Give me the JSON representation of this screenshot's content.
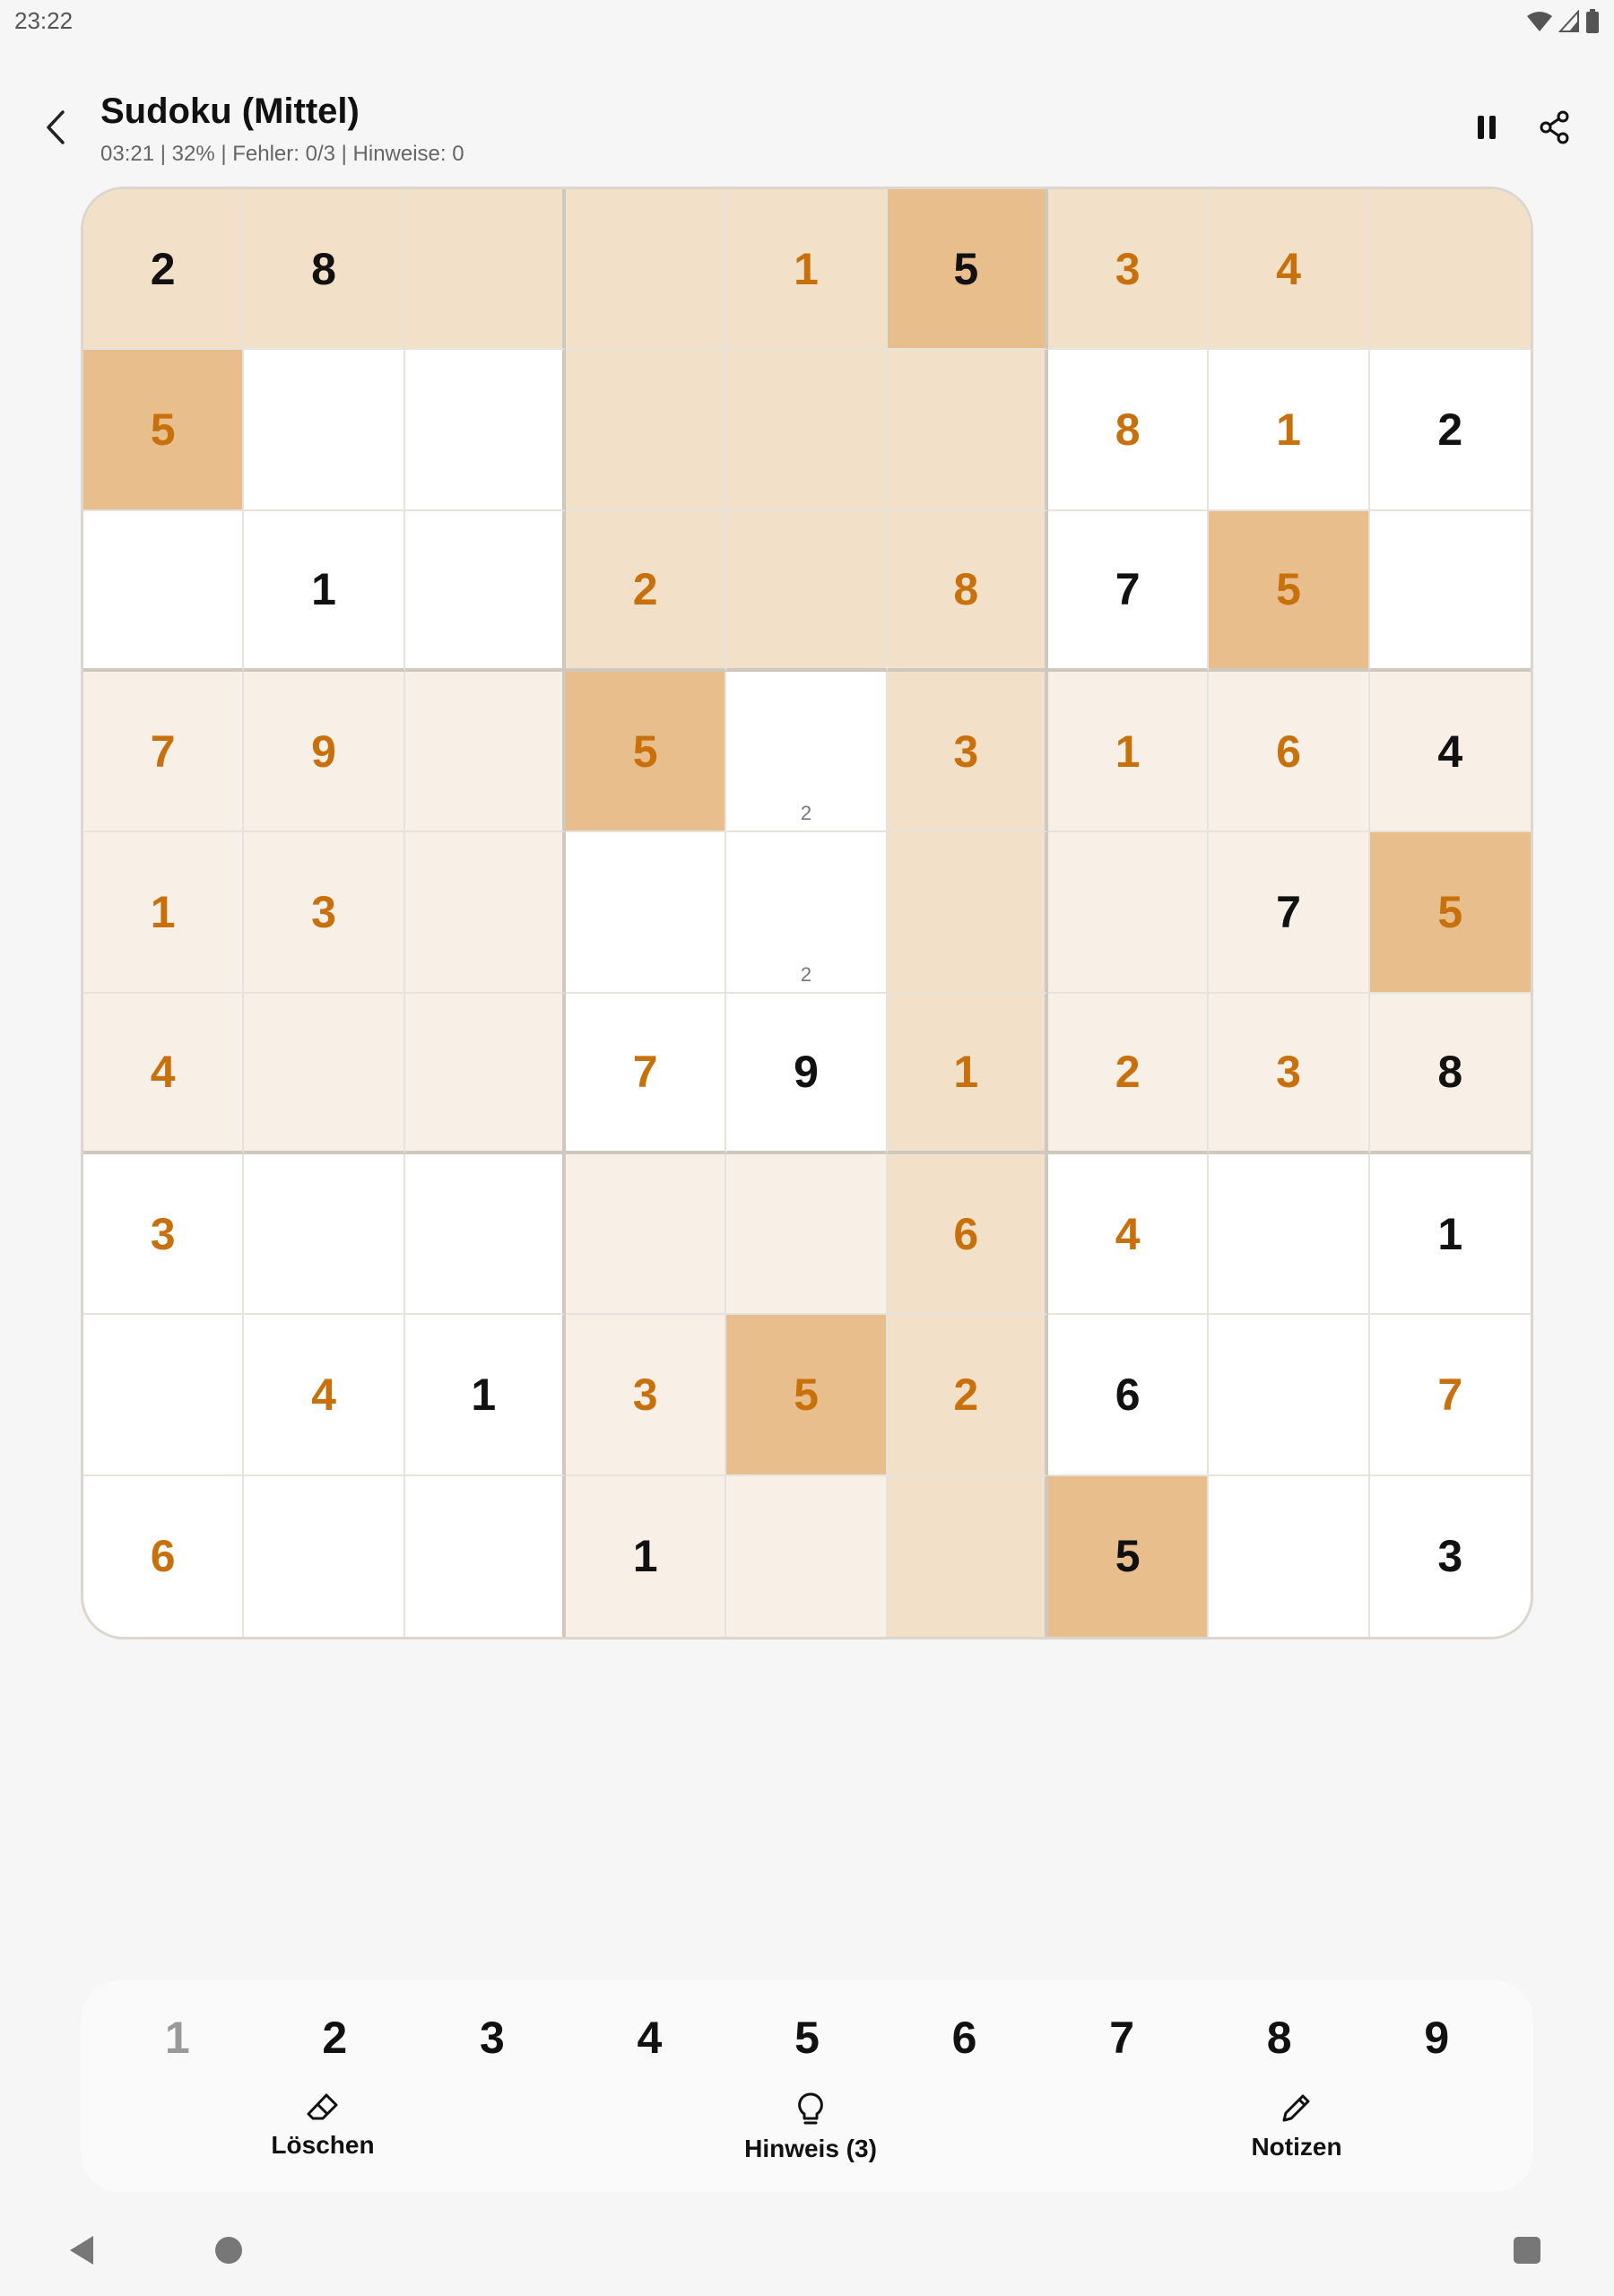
{
  "status_bar": {
    "time": "23:22"
  },
  "header": {
    "title": "Sudoku (Mittel)",
    "subtitle": "03:21 | 32% | Fehler: 0/3 | Hinweise: 0"
  },
  "colors": {
    "accent_orange": "#c8700c",
    "selected_number_cell": "#e8bf8c",
    "highlight_medium": "#f2e1c8",
    "highlight_light": "#f8f0e6",
    "background": "#f6f6f6"
  },
  "board": {
    "selected_number": "5",
    "cells": [
      [
        {
          "v": "2",
          "t": "given",
          "bg": "m"
        },
        {
          "v": "8",
          "t": "given",
          "bg": "m"
        },
        {
          "v": "",
          "bg": "m"
        },
        {
          "v": "",
          "bg": "m"
        },
        {
          "v": "1",
          "t": "entered",
          "bg": "m"
        },
        {
          "v": "5",
          "t": "given",
          "bg": "s"
        },
        {
          "v": "3",
          "t": "entered",
          "bg": "m"
        },
        {
          "v": "4",
          "t": "entered",
          "bg": "m"
        },
        {
          "v": "",
          "bg": "m"
        }
      ],
      [
        {
          "v": "5",
          "t": "entered",
          "bg": "s"
        },
        {
          "v": "",
          "bg": "b"
        },
        {
          "v": "",
          "bg": "b"
        },
        {
          "v": "",
          "bg": "m"
        },
        {
          "v": "",
          "bg": "m"
        },
        {
          "v": "",
          "bg": "m"
        },
        {
          "v": "8",
          "t": "entered",
          "bg": "b"
        },
        {
          "v": "1",
          "t": "entered",
          "bg": "b"
        },
        {
          "v": "2",
          "t": "given",
          "bg": "b"
        }
      ],
      [
        {
          "v": "",
          "bg": "b"
        },
        {
          "v": "1",
          "t": "given",
          "bg": "b"
        },
        {
          "v": "",
          "bg": "b"
        },
        {
          "v": "2",
          "t": "entered",
          "bg": "m"
        },
        {
          "v": "",
          "bg": "m"
        },
        {
          "v": "8",
          "t": "entered",
          "bg": "m"
        },
        {
          "v": "7",
          "t": "given",
          "bg": "b"
        },
        {
          "v": "5",
          "t": "entered",
          "bg": "s"
        },
        {
          "v": "",
          "bg": "b"
        }
      ],
      [
        {
          "v": "7",
          "t": "entered",
          "bg": "l"
        },
        {
          "v": "9",
          "t": "entered",
          "bg": "l"
        },
        {
          "v": "",
          "bg": "l"
        },
        {
          "v": "5",
          "t": "entered",
          "bg": "s"
        },
        {
          "v": "",
          "note": "2",
          "bg": "b"
        },
        {
          "v": "3",
          "t": "entered",
          "bg": "m"
        },
        {
          "v": "1",
          "t": "entered",
          "bg": "l"
        },
        {
          "v": "6",
          "t": "entered",
          "bg": "l"
        },
        {
          "v": "4",
          "t": "given",
          "bg": "l"
        }
      ],
      [
        {
          "v": "1",
          "t": "entered",
          "bg": "l"
        },
        {
          "v": "3",
          "t": "entered",
          "bg": "l"
        },
        {
          "v": "",
          "bg": "l"
        },
        {
          "v": "",
          "bg": "b"
        },
        {
          "v": "",
          "note": "2",
          "bg": "b"
        },
        {
          "v": "",
          "bg": "m"
        },
        {
          "v": "",
          "bg": "l"
        },
        {
          "v": "7",
          "t": "given",
          "bg": "l"
        },
        {
          "v": "5",
          "t": "entered",
          "bg": "s"
        }
      ],
      [
        {
          "v": "4",
          "t": "entered",
          "bg": "l"
        },
        {
          "v": "",
          "bg": "l"
        },
        {
          "v": "",
          "bg": "l"
        },
        {
          "v": "7",
          "t": "entered",
          "bg": "b"
        },
        {
          "v": "9",
          "t": "given",
          "bg": "b"
        },
        {
          "v": "1",
          "t": "entered",
          "bg": "m"
        },
        {
          "v": "2",
          "t": "entered",
          "bg": "l"
        },
        {
          "v": "3",
          "t": "entered",
          "bg": "l"
        },
        {
          "v": "8",
          "t": "given",
          "bg": "l"
        }
      ],
      [
        {
          "v": "3",
          "t": "entered",
          "bg": "b"
        },
        {
          "v": "",
          "bg": "b"
        },
        {
          "v": "",
          "bg": "b"
        },
        {
          "v": "",
          "bg": "l"
        },
        {
          "v": "",
          "bg": "l"
        },
        {
          "v": "6",
          "t": "entered",
          "bg": "m"
        },
        {
          "v": "4",
          "t": "entered",
          "bg": "b"
        },
        {
          "v": "",
          "bg": "b"
        },
        {
          "v": "1",
          "t": "given",
          "bg": "b"
        }
      ],
      [
        {
          "v": "",
          "bg": "b"
        },
        {
          "v": "4",
          "t": "entered",
          "bg": "b"
        },
        {
          "v": "1",
          "t": "given",
          "bg": "b"
        },
        {
          "v": "3",
          "t": "entered",
          "bg": "l"
        },
        {
          "v": "5",
          "t": "entered",
          "bg": "s"
        },
        {
          "v": "2",
          "t": "entered",
          "bg": "m"
        },
        {
          "v": "6",
          "t": "given",
          "bg": "b"
        },
        {
          "v": "",
          "bg": "b"
        },
        {
          "v": "7",
          "t": "entered",
          "bg": "b"
        }
      ],
      [
        {
          "v": "6",
          "t": "entered",
          "bg": "b"
        },
        {
          "v": "",
          "bg": "b"
        },
        {
          "v": "",
          "bg": "b"
        },
        {
          "v": "1",
          "t": "given",
          "bg": "l"
        },
        {
          "v": "",
          "bg": "l"
        },
        {
          "v": "",
          "bg": "m"
        },
        {
          "v": "5",
          "t": "given",
          "bg": "s"
        },
        {
          "v": "",
          "bg": "b"
        },
        {
          "v": "3",
          "t": "given",
          "bg": "b"
        }
      ]
    ]
  },
  "numpad": [
    {
      "label": "1",
      "done": true
    },
    {
      "label": "2"
    },
    {
      "label": "3"
    },
    {
      "label": "4"
    },
    {
      "label": "5"
    },
    {
      "label": "6"
    },
    {
      "label": "7"
    },
    {
      "label": "8"
    },
    {
      "label": "9"
    }
  ],
  "actions": {
    "erase_label": "Löschen",
    "hint_label": "Hinweis (3)",
    "notes_label": "Notizen"
  }
}
